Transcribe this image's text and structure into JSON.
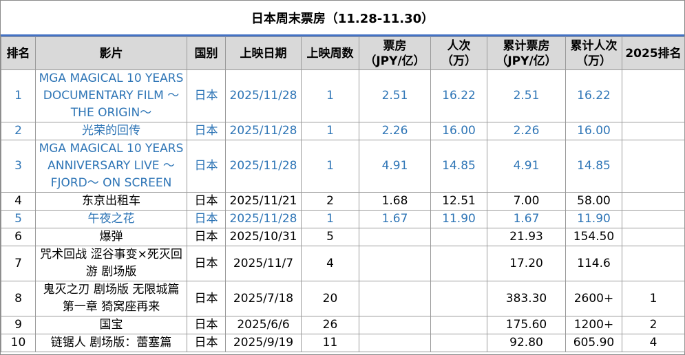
{
  "title": "日本周末票房（11.28-11.30）",
  "columns": [
    "排名",
    "影片",
    "国别",
    "上映日期",
    "上映周数",
    "票房\n（JPY/亿）",
    "人次\n（万）",
    "累计票房\n（JPY/亿）",
    "累计人次\n（万）",
    "2025排名"
  ],
  "rows": [
    {
      "rank": "1",
      "film": "MGA MAGICAL 10 YEARS DOCUMENTARY FILM ～ THE ORIGIN～",
      "country": "日本",
      "date": "2025/11/28",
      "weeks": "1",
      "gross": "2.51",
      "admissions": "16.22",
      "total_gross": "2.51",
      "total_admissions": "16.22",
      "rank_2025": ""
    },
    {
      "rank": "2",
      "film": "光荣的回传",
      "country": "日本",
      "date": "2025/11/28",
      "weeks": "1",
      "gross": "2.26",
      "admissions": "16.00",
      "total_gross": "2.26",
      "total_admissions": "16.00",
      "rank_2025": ""
    },
    {
      "rank": "3",
      "film": "MGA MAGICAL 10 YEARS ANNIVERSARY LIVE ～ FJORD～ ON SCREEN",
      "country": "日本",
      "date": "2025/11/28",
      "weeks": "1",
      "gross": "4.91",
      "admissions": "14.85",
      "total_gross": "4.91",
      "total_admissions": "14.85",
      "rank_2025": ""
    },
    {
      "rank": "4",
      "film": "东京出租车",
      "country": "日本",
      "date": "2025/11/21",
      "weeks": "2",
      "gross": "1.68",
      "admissions": "12.51",
      "total_gross": "7.00",
      "total_admissions": "58.00",
      "rank_2025": ""
    },
    {
      "rank": "5",
      "film": "午夜之花",
      "country": "日本",
      "date": "2025/11/28",
      "weeks": "1",
      "gross": "1.67",
      "admissions": "11.90",
      "total_gross": "1.67",
      "total_admissions": "11.90",
      "rank_2025": ""
    },
    {
      "rank": "6",
      "film": "爆弹",
      "country": "日本",
      "date": "2025/10/31",
      "weeks": "5",
      "gross": "",
      "admissions": "",
      "total_gross": "21.93",
      "total_admissions": "154.50",
      "rank_2025": ""
    },
    {
      "rank": "7",
      "film": "咒术回战 涩谷事变×死灭回游 剧场版",
      "country": "日本",
      "date": "2025/11/7",
      "weeks": "4",
      "gross": "",
      "admissions": "",
      "total_gross": "17.20",
      "total_admissions": "114.6",
      "rank_2025": ""
    },
    {
      "rank": "8",
      "film": "鬼灭之刃 剧场版 无限城篇 第一章 猗窝座再来",
      "country": "日本",
      "date": "2025/7/18",
      "weeks": "20",
      "gross": "",
      "admissions": "",
      "total_gross": "383.30",
      "total_admissions": "2600+",
      "rank_2025": "1"
    },
    {
      "rank": "9",
      "film": "国宝",
      "country": "日本",
      "date": "2025/6/6",
      "weeks": "26",
      "gross": "",
      "admissions": "",
      "total_gross": "175.60",
      "total_admissions": "1200+",
      "rank_2025": "2"
    },
    {
      "rank": "10",
      "film": "链锯人 剧场版：蕾塞篇",
      "country": "日本",
      "date": "2025/9/19",
      "weeks": "11",
      "gross": "",
      "admissions": "",
      "total_gross": "92.80",
      "total_admissions": "605.90",
      "rank_2025": "4"
    }
  ],
  "colors": {
    "highlight_text": "#2e75b6",
    "header_bg": "#d9d9d9",
    "title_rule": "#4472c4"
  }
}
